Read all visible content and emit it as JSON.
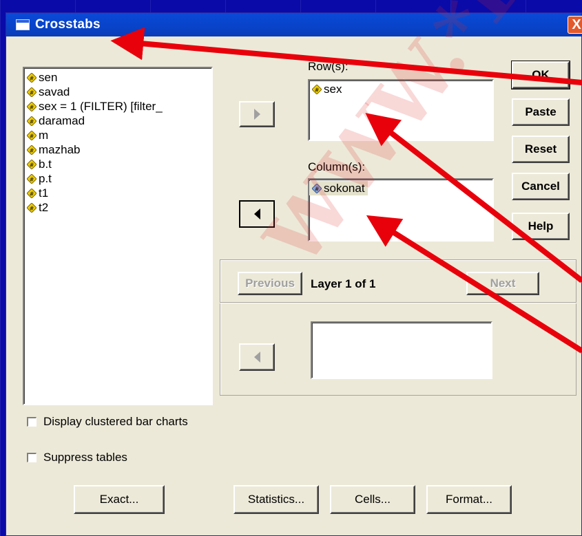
{
  "dialog": {
    "title": "Crosstabs",
    "close_glyph": "X"
  },
  "variables": [
    {
      "name": "sen",
      "icon": "scale-variable-icon"
    },
    {
      "name": "savad",
      "icon": "scale-variable-icon"
    },
    {
      "name": "sex = 1 (FILTER) [filter_",
      "icon": "scale-variable-icon"
    },
    {
      "name": "daramad",
      "icon": "scale-variable-icon"
    },
    {
      "name": "m",
      "icon": "scale-variable-icon"
    },
    {
      "name": "mazhab",
      "icon": "scale-variable-icon"
    },
    {
      "name": "b.t",
      "icon": "scale-variable-icon"
    },
    {
      "name": "p.t",
      "icon": "scale-variable-icon"
    },
    {
      "name": "t1",
      "icon": "scale-variable-icon"
    },
    {
      "name": "t2",
      "icon": "scale-variable-icon"
    }
  ],
  "rows": {
    "label": "Row(s):",
    "items": [
      {
        "name": "sex",
        "icon": "scale-variable-icon"
      }
    ]
  },
  "columns": {
    "label": "Column(s):",
    "items": [
      {
        "name": "sokonat",
        "icon": "nominal-variable-icon"
      }
    ]
  },
  "layer": {
    "previous_label": "Previous",
    "status_text": "Layer 1 of 1",
    "next_label": "Next"
  },
  "side_buttons": {
    "ok": "OK",
    "paste": "Paste",
    "reset": "Reset",
    "cancel": "Cancel",
    "help": "Help"
  },
  "checkboxes": {
    "clustered": {
      "label": "Display clustered bar charts",
      "checked": false
    },
    "suppress": {
      "label": "Suppress tables",
      "checked": false
    }
  },
  "bottom_buttons": {
    "exact": "Exact...",
    "statistics": "Statistics...",
    "cells": "Cells...",
    "format": "Format..."
  },
  "watermark": "WWW.*PN",
  "colors": {
    "desktop": "#0a0aa8",
    "dialog_bg": "#ece9d8",
    "titlebar": "#0843c8",
    "annotation_arrow": "#e8000b"
  }
}
